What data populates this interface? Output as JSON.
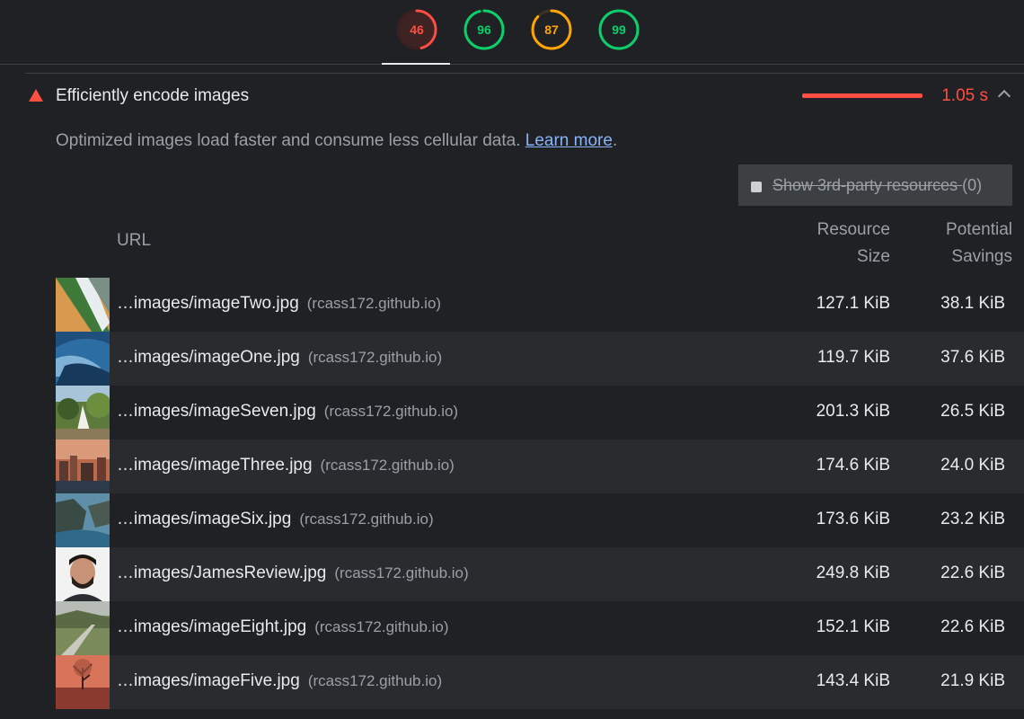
{
  "scores": [
    {
      "value": "46",
      "color": "#ff4e42",
      "fraction": 0.46,
      "active": true
    },
    {
      "value": "96",
      "color": "#0cce6b",
      "fraction": 0.96,
      "active": false
    },
    {
      "value": "87",
      "color": "#ffa400",
      "fraction": 0.87,
      "active": false
    },
    {
      "value": "99",
      "color": "#0cce6b",
      "fraction": 0.99,
      "active": false
    }
  ],
  "audit": {
    "title": "Efficiently encode images",
    "savings": "1.05 s",
    "description": "Optimized images load faster and consume less cellular data.",
    "learn_more": "Learn more",
    "period": ".",
    "status_color": "#ff4e42"
  },
  "filter": {
    "label": "Show 3rd-party resources",
    "count": "(0)"
  },
  "table": {
    "col_url": "URL",
    "col_size_1": "Resource",
    "col_size_2": "Size",
    "col_savings_1": "Potential",
    "col_savings_2": "Savings",
    "rows": [
      {
        "url": "…images/imageTwo.jpg",
        "host": "(rcass172.github.io)",
        "size": "127.1 KiB",
        "savings": "38.1 KiB",
        "thumb": "beach"
      },
      {
        "url": "…images/imageOne.jpg",
        "host": "(rcass172.github.io)",
        "size": "119.7 KiB",
        "savings": "37.6 KiB",
        "thumb": "wave"
      },
      {
        "url": "…images/imageSeven.jpg",
        "host": "(rcass172.github.io)",
        "size": "201.3 KiB",
        "savings": "26.5 KiB",
        "thumb": "garden"
      },
      {
        "url": "…images/imageThree.jpg",
        "host": "(rcass172.github.io)",
        "size": "174.6 KiB",
        "savings": "24.0 KiB",
        "thumb": "city"
      },
      {
        "url": "…images/imageSix.jpg",
        "host": "(rcass172.github.io)",
        "size": "173.6 KiB",
        "savings": "23.2 KiB",
        "thumb": "coast"
      },
      {
        "url": "…images/JamesReview.jpg",
        "host": "(rcass172.github.io)",
        "size": "249.8 KiB",
        "savings": "22.6 KiB",
        "thumb": "portrait"
      },
      {
        "url": "…images/imageEight.jpg",
        "host": "(rcass172.github.io)",
        "size": "152.1 KiB",
        "savings": "22.6 KiB",
        "thumb": "road"
      },
      {
        "url": "…images/imageFive.jpg",
        "host": "(rcass172.github.io)",
        "size": "143.4 KiB",
        "savings": "21.9 KiB",
        "thumb": "sunset"
      }
    ]
  }
}
